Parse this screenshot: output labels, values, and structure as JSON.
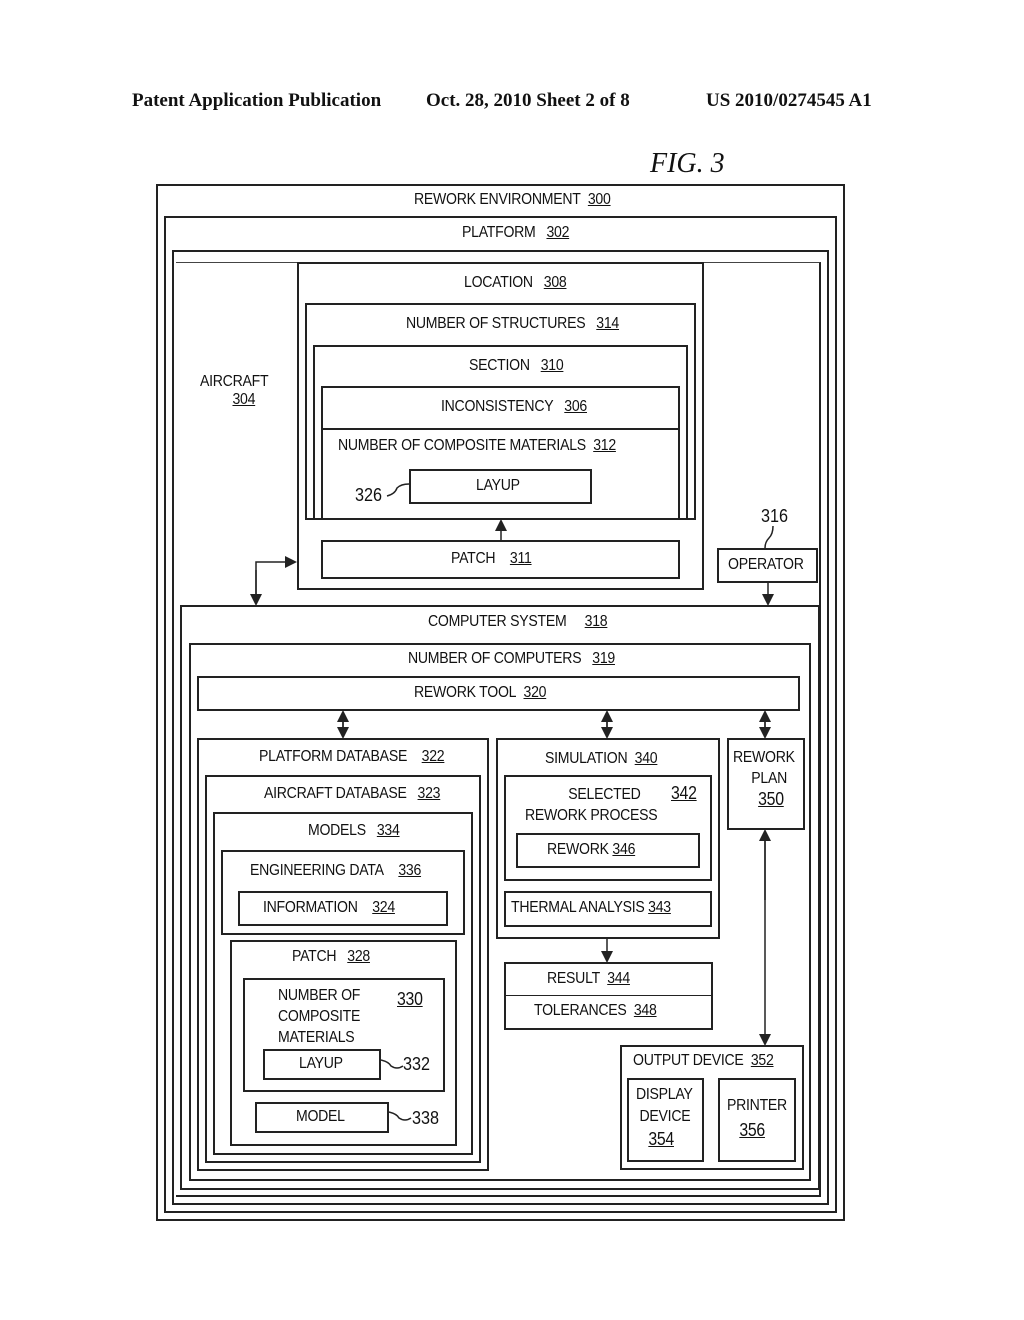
{
  "header": {
    "left": "Patent Application Publication",
    "center": "Oct. 28, 2010   Sheet 2 of 8",
    "right": "US 2010/0274545 A1"
  },
  "figure_label": "FIG. 3",
  "boxes": {
    "rework_environment": {
      "label": "REWORK ENVIRONMENT",
      "num": "300"
    },
    "platform": {
      "label": "PLATFORM",
      "num": "302"
    },
    "aircraft": {
      "label": "AIRCRAFT",
      "num": "304"
    },
    "location": {
      "label": "LOCATION",
      "num": "308"
    },
    "number_of_structures": {
      "label": "NUMBER OF STRUCTURES",
      "num": "314"
    },
    "section": {
      "label": "SECTION",
      "num": "310"
    },
    "inconsistency": {
      "label": "INCONSISTENCY",
      "num": "306"
    },
    "composite_materials_312": {
      "label": "NUMBER OF COMPOSITE MATERIALS",
      "num": "312"
    },
    "layup_326": {
      "label": "LAYUP",
      "ref": "326"
    },
    "patch_311": {
      "label": "PATCH",
      "num": "311"
    },
    "operator": {
      "label": "OPERATOR",
      "ref": "316"
    },
    "computer_system": {
      "label": "COMPUTER SYSTEM",
      "num": "318"
    },
    "number_of_computers": {
      "label": "NUMBER OF COMPUTERS",
      "num": "319"
    },
    "rework_tool": {
      "label": "REWORK TOOL",
      "num": "320"
    },
    "platform_database": {
      "label": "PLATFORM DATABASE",
      "num": "322"
    },
    "aircraft_database": {
      "label": "AIRCRAFT DATABASE",
      "num": "323"
    },
    "models": {
      "label": "MODELS",
      "num": "334"
    },
    "engineering_data": {
      "label": "ENGINEERING DATA",
      "num": "336"
    },
    "information": {
      "label": "INFORMATION",
      "num": "324"
    },
    "patch_328": {
      "label": "PATCH",
      "num": "328"
    },
    "composite_materials_330": {
      "label1": "NUMBER OF",
      "label2": "COMPOSITE",
      "label3": "MATERIALS",
      "num": "330"
    },
    "layup_332": {
      "label": "LAYUP",
      "ref": "332"
    },
    "model_338": {
      "label": "MODEL",
      "ref": "338"
    },
    "simulation": {
      "label": "SIMULATION",
      "num": "340"
    },
    "selected_rework_process": {
      "label1": "SELECTED",
      "label2": "REWORK PROCESS",
      "num": "342"
    },
    "rework_346": {
      "label": "REWORK",
      "num": "346"
    },
    "thermal_analysis": {
      "label": "THERMAL ANALYSIS",
      "num": "343"
    },
    "rework_plan": {
      "label1": "REWORK",
      "label2": "PLAN",
      "num": "350"
    },
    "result": {
      "label": "RESULT",
      "num": "344"
    },
    "tolerances": {
      "label": "TOLERANCES",
      "num": "348"
    },
    "output_device": {
      "label": "OUTPUT DEVICE",
      "num": "352"
    },
    "display_device": {
      "label1": "DISPLAY",
      "label2": "DEVICE",
      "num": "354"
    },
    "printer": {
      "label": "PRINTER",
      "num": "356"
    }
  }
}
